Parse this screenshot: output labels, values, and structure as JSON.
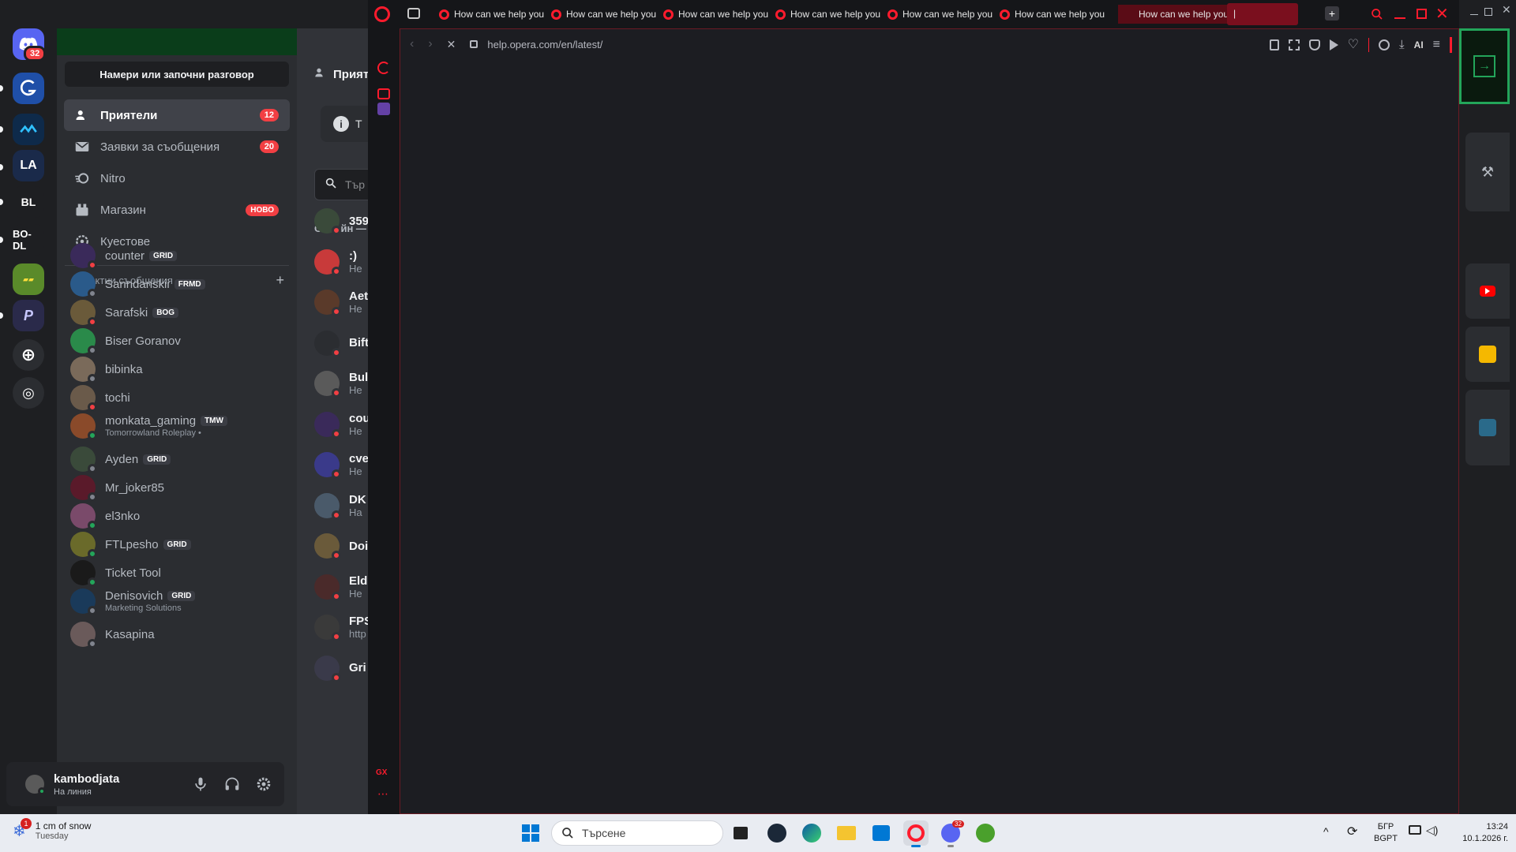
{
  "discord": {
    "server_badge": "32",
    "servers": [
      "BL",
      "BO-DL"
    ],
    "find_conversation": "Намери или започни разговор",
    "nav": [
      {
        "label": "Приятели",
        "count": "12"
      },
      {
        "label": "Заявки за съобщения",
        "count": "20"
      },
      {
        "label": "Nitro"
      },
      {
        "label": "Магазин",
        "badge": "НОВО"
      },
      {
        "label": "Куестове"
      }
    ],
    "dm_header": "Директни съобщения",
    "dm_add": "+",
    "dms": [
      {
        "name": "counter",
        "tag": "GRID",
        "color": "#3a2a5a",
        "status": "#f23f43"
      },
      {
        "name": "Sanndanskii",
        "tag": "FRMD",
        "color": "#2a5a8a",
        "status": "#80848e"
      },
      {
        "name": "Sarafski",
        "tag": "BOG",
        "color": "#6a5a3a",
        "status": "#f23f43"
      },
      {
        "name": "Biser Goranov",
        "color": "#2a8a4a",
        "status": "#80848e"
      },
      {
        "name": "bibinka",
        "color": "#7a6a5a",
        "status": "#80848e"
      },
      {
        "name": "tochi",
        "color": "#6a5a4a",
        "status": "#f23f43"
      },
      {
        "name": "monkata_gaming",
        "tag": "TMW",
        "sub": "Tomorrowland Roleplay •",
        "color": "#8a4a2a",
        "status": "#23a55a"
      },
      {
        "name": "Ayden",
        "tag": "GRID",
        "color": "#3a4a3a",
        "status": "#80848e"
      },
      {
        "name": "Mr_joker85",
        "color": "#5a1a2a",
        "status": "#80848e"
      },
      {
        "name": "el3nko",
        "color": "#7a4a6a",
        "status": "#23a55a"
      },
      {
        "name": "FTLpesho",
        "tag": "GRID",
        "color": "#6a6a2a",
        "status": "#23a55a"
      },
      {
        "name": "Ticket Tool",
        "color": "#1a1a1a",
        "status": "#23a55a"
      },
      {
        "name": "Denisovich",
        "tag": "GRID",
        "sub": "Marketing Solutions",
        "color": "#1a3a5a",
        "status": "#80848e"
      },
      {
        "name": "Kasapina",
        "color": "#6a5a5a",
        "status": "#80848e"
      }
    ],
    "user": {
      "name": "kambodjata",
      "status": "На линия"
    },
    "friends_header": "Приятели",
    "online_header": "Онлайн —",
    "search_prefix": "Тър",
    "info_prefix": "Т",
    "friends": [
      {
        "name": "359",
        "sub": "",
        "color": "#3a4a3a"
      },
      {
        "name": ":)",
        "sub": "Не",
        "color": "#c83a3a"
      },
      {
        "name": "Aet",
        "sub": "Не",
        "color": "#5a3a2a"
      },
      {
        "name": "Bift",
        "sub": "",
        "color": "#2b2d31"
      },
      {
        "name": "Bul",
        "sub": "Не",
        "color": "#5a5a5a"
      },
      {
        "name": "cou",
        "sub": "Не",
        "color": "#3a2a5a"
      },
      {
        "name": "cve",
        "sub": "Не",
        "color": "#3a3a8a"
      },
      {
        "name": "DK",
        "sub": "На",
        "color": "#4a5a6a"
      },
      {
        "name": "Doi",
        "sub": "",
        "color": "#6a5a3a"
      },
      {
        "name": "Eld",
        "sub": "Не",
        "color": "#4a2a2a"
      },
      {
        "name": "FPS",
        "sub": "http",
        "color": "#3a3a3a"
      },
      {
        "name": "Gri",
        "sub": "",
        "color": "#3a3a4a"
      }
    ]
  },
  "opera": {
    "tab_title": "How can we help you",
    "tabs_count": 7,
    "url": "help.opera.com/en/latest/",
    "ai_label": "AI",
    "sidebar_gx": "GX"
  },
  "taskbar": {
    "weather_badge": "1",
    "weather": "1 cm of snow",
    "weather_day": "Tuesday",
    "search": "Търсене",
    "lang": "БГР",
    "lang_sub": "BGPT",
    "time": "13:24",
    "date": "10.1.2026 г.",
    "discord_badge": "32"
  },
  "colors": {
    "discord_blurple": "#5865f2",
    "opera_red": "#ff1b2d",
    "discord_red": "#f23f43",
    "green_accent": "#23a55a"
  }
}
